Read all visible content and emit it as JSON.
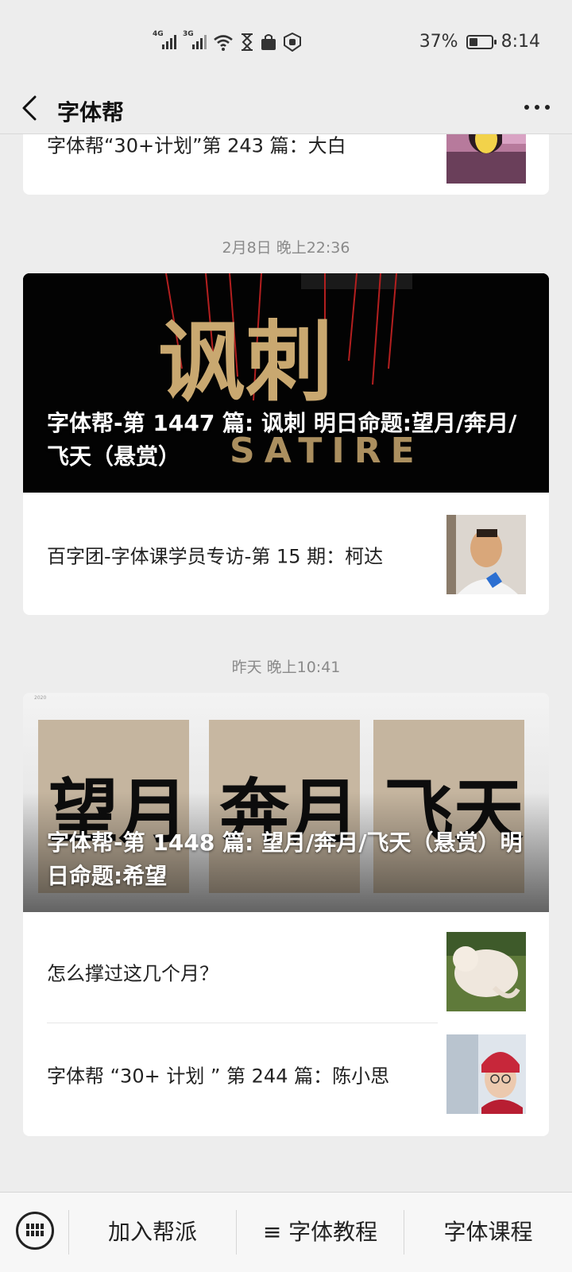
{
  "status_bar": {
    "net1": "4G",
    "net2": "3G",
    "battery_text": "37%",
    "battery_level": 0.37,
    "time": "8:14"
  },
  "nav": {
    "title": "字体帮"
  },
  "feed": {
    "partial_item": {
      "title": "字体帮“30+计划”第 243 篇：大白"
    },
    "group1": {
      "timestamp": "2月8日 晚上22:36",
      "hero_title": "字体帮-第 1447 篇: 讽刺  明日命题:望月/奔月/飞天（悬赏）",
      "hero_art_text": "讽刺",
      "hero_art_sub": "SATIRE",
      "item": "百字团-字体课学员专访-第 15 期：柯达"
    },
    "group2": {
      "timestamp": "昨天 晚上10:41",
      "hero_title": "字体帮-第 1448 篇: 望月/奔月/飞天（悬赏）明日命题:希望",
      "hero_chars": [
        "望月",
        "奔月",
        "飞天"
      ],
      "hero_corner": "2020",
      "items": [
        "怎么撑过这几个月？",
        "字体帮 “30+ 计划 ” 第 244 篇：陈小思"
      ]
    }
  },
  "bottom_menu": {
    "item1": "加入帮派",
    "item2": "≡ 字体教程",
    "item3": "字体课程"
  },
  "colors": {
    "background": "#ededed",
    "card": "#ffffff",
    "hero_dark": "#000000",
    "art_gold": "#c9a870"
  }
}
